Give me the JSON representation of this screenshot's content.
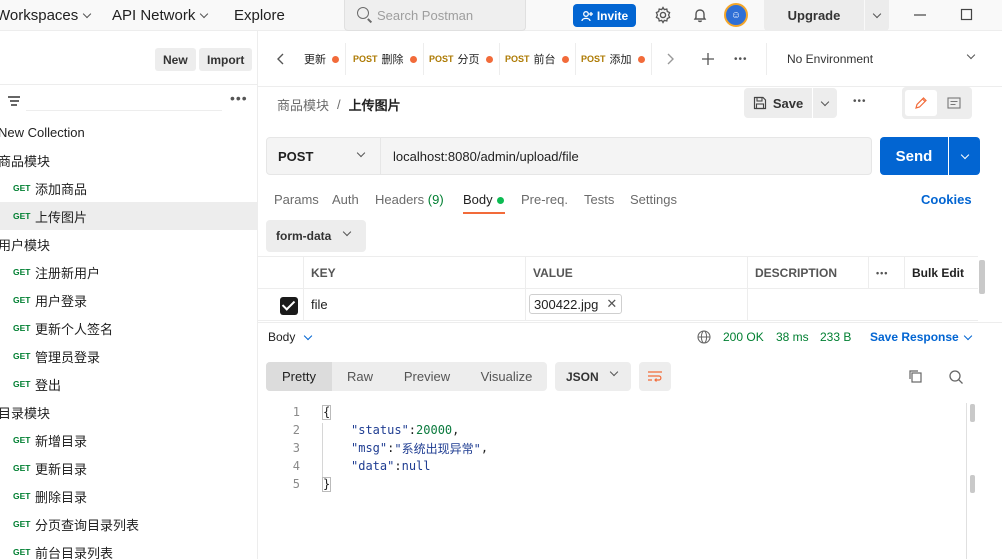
{
  "topbar": {
    "workspaces_label": "Workspaces",
    "api_network_label": "API Network",
    "explore_label": "Explore",
    "search_placeholder": "Search Postman",
    "invite_label": "Invite",
    "upgrade_label": "Upgrade"
  },
  "sidebar": {
    "new_label": "New",
    "import_label": "Import",
    "new_collection_label": "New Collection",
    "tree": [
      {
        "type": "folder",
        "label": "商品模块"
      },
      {
        "type": "request",
        "method": "GET",
        "label": "添加商品"
      },
      {
        "type": "request",
        "method": "GET",
        "label": "上传图片",
        "selected": true
      },
      {
        "type": "folder",
        "label": "用户模块"
      },
      {
        "type": "request",
        "method": "GET",
        "label": "注册新用户"
      },
      {
        "type": "request",
        "method": "GET",
        "label": "用户登录"
      },
      {
        "type": "request",
        "method": "GET",
        "label": "更新个人签名"
      },
      {
        "type": "request",
        "method": "GET",
        "label": "管理员登录"
      },
      {
        "type": "request",
        "method": "GET",
        "label": "登出"
      },
      {
        "type": "folder",
        "label": "目录模块"
      },
      {
        "type": "request",
        "method": "GET",
        "label": "新增目录"
      },
      {
        "type": "request",
        "method": "GET",
        "label": "更新目录"
      },
      {
        "type": "request",
        "method": "GET",
        "label": "删除目录"
      },
      {
        "type": "request",
        "method": "GET",
        "label": "分页查询目录列表"
      },
      {
        "type": "request",
        "method": "GET",
        "label": "前台目录列表"
      }
    ]
  },
  "tabs": {
    "items": [
      {
        "method": "",
        "label": "更新"
      },
      {
        "method": "POST",
        "label": "删除"
      },
      {
        "method": "POST",
        "label": "分页"
      },
      {
        "method": "POST",
        "label": "前台"
      },
      {
        "method": "POST",
        "label": "添加"
      }
    ],
    "environment": "No Environment"
  },
  "request": {
    "breadcrumb_parent": "商品模块",
    "breadcrumb_separator": "/",
    "breadcrumb_current": "上传图片",
    "save_label": "Save",
    "method": "POST",
    "url": "localhost:8080/admin/upload/file",
    "send_label": "Send",
    "tabs": {
      "params": "Params",
      "auth": "Auth",
      "headers": "Headers",
      "headers_count": "(9)",
      "body": "Body",
      "prereq": "Pre-req.",
      "tests": "Tests",
      "settings": "Settings"
    },
    "cookies_label": "Cookies",
    "body_mode": "form-data",
    "table": {
      "headers": {
        "key": "KEY",
        "value": "VALUE",
        "description": "DESCRIPTION",
        "bulk_edit": "Bulk Edit"
      },
      "rows": [
        {
          "key": "file",
          "value": "300422.jpg",
          "description": "",
          "checked": true
        }
      ]
    }
  },
  "response": {
    "body_label": "Body",
    "status": "200 OK",
    "time": "38 ms",
    "size": "233 B",
    "save_response_label": "Save Response",
    "formats": [
      "Pretty",
      "Raw",
      "Preview",
      "Visualize"
    ],
    "active_format": "Pretty",
    "language": "JSON",
    "code_lines": [
      {
        "n": "1",
        "text": "{"
      },
      {
        "n": "2",
        "key": "\"status\"",
        "value": "20000",
        "value_type": "number",
        "suffix": ","
      },
      {
        "n": "3",
        "key": "\"msg\"",
        "value": "\"系统出现异常\"",
        "value_type": "string",
        "suffix": ","
      },
      {
        "n": "4",
        "key": "\"data\"",
        "value": "null",
        "value_type": "keyword",
        "suffix": ""
      },
      {
        "n": "5",
        "text": "}"
      }
    ]
  },
  "colors": {
    "primary": "#0265d2",
    "get_method": "#007f31",
    "post_method": "#ad7a03",
    "unsaved_dot": "#f26b3a",
    "status_ok": "#007f31"
  }
}
